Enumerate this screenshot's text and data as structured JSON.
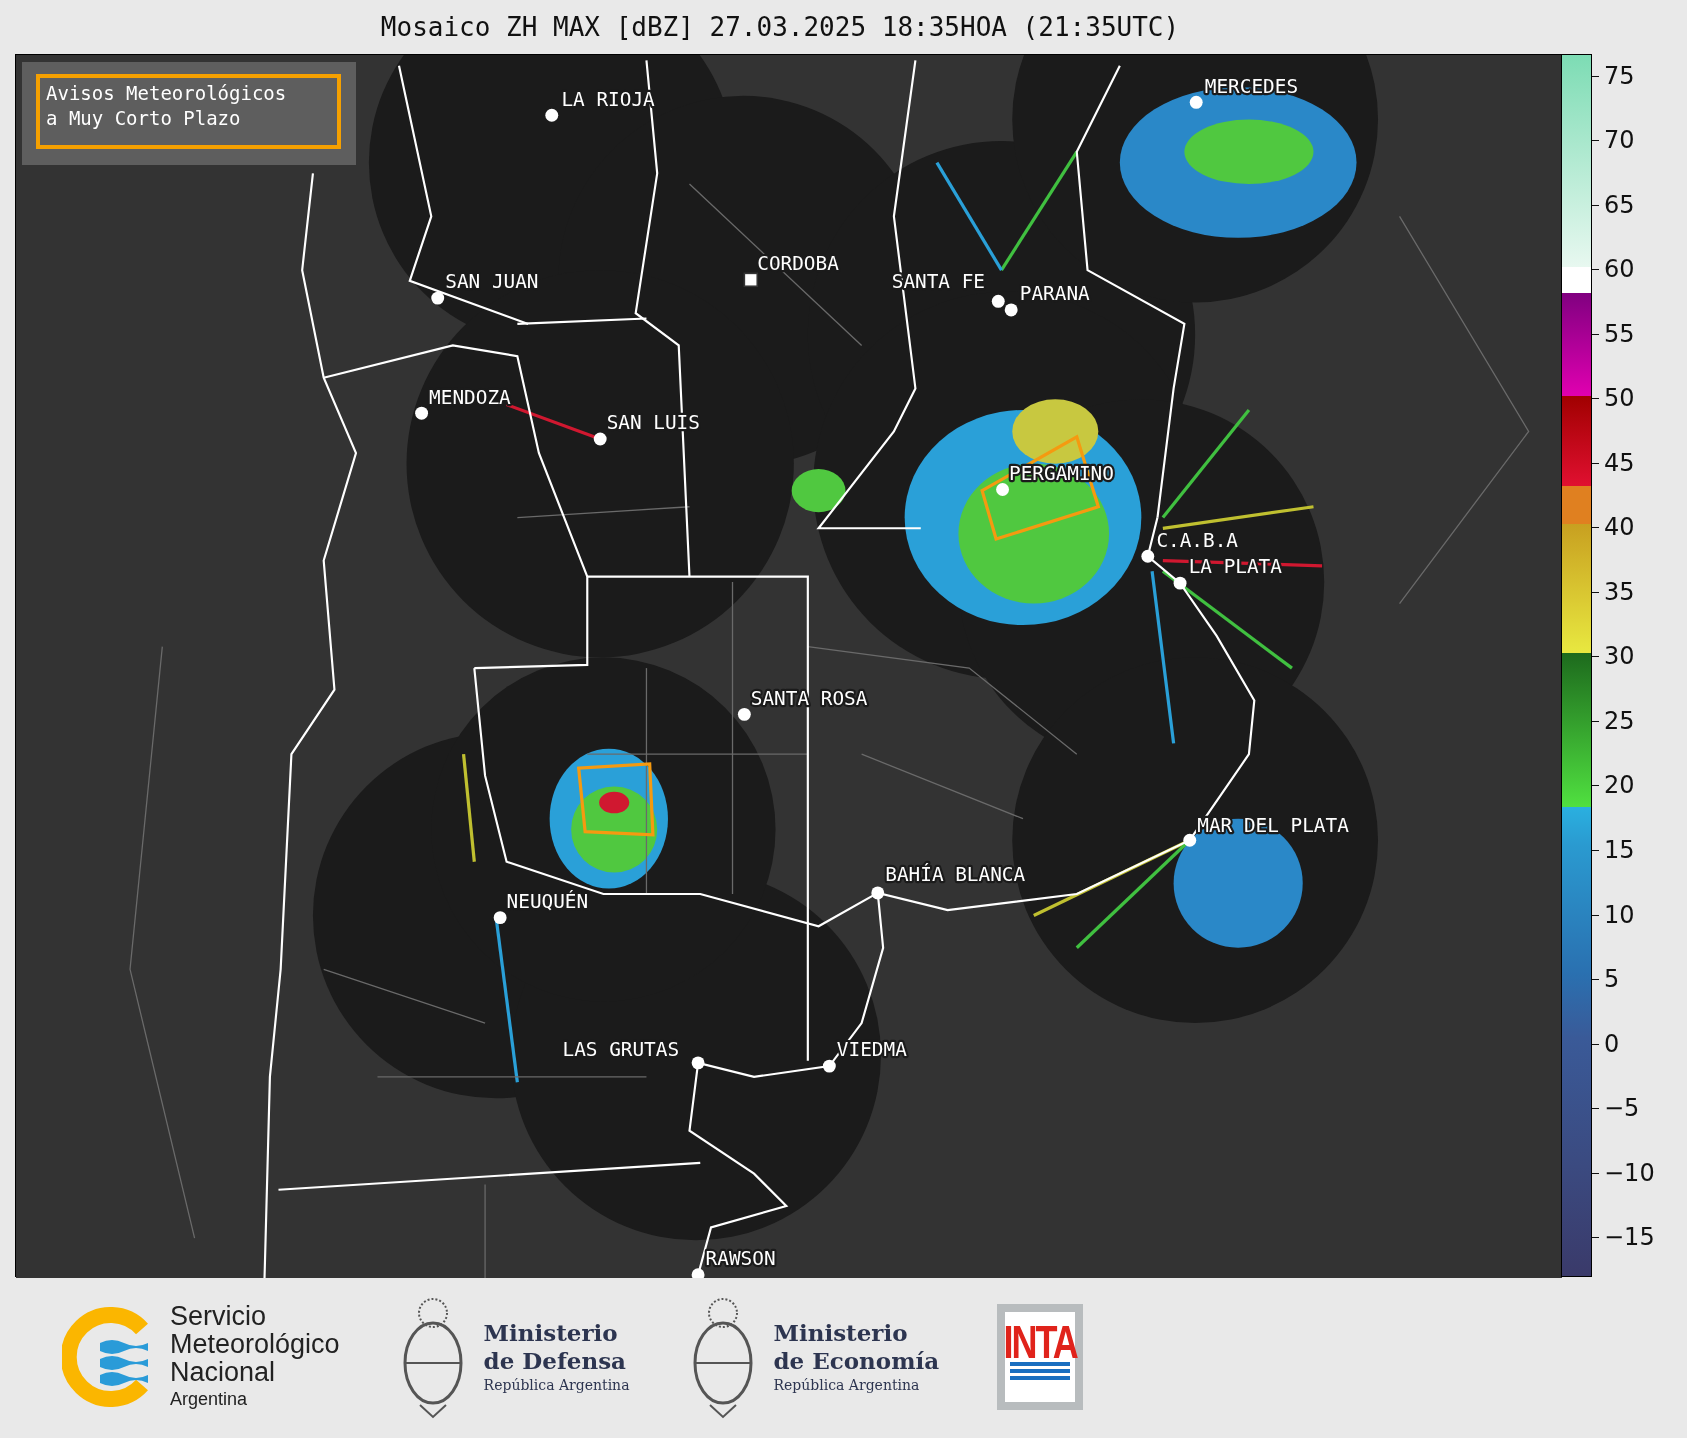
{
  "title": "Mosaico ZH MAX [dBZ] 27.03.2025 18:35HOA (21:35UTC)",
  "map": {
    "legend_box": {
      "lines": [
        "Avisos Meteorológicos",
        "a Muy Corto Plazo"
      ]
    },
    "cities": [
      "LA RIOJA",
      "SAN JUAN",
      "CORDOBA",
      "SANTA FE",
      "PARANA",
      "MENDOZA",
      "SAN LUIS",
      "MERCEDES",
      "PERGAMINO",
      "C.A.B.A",
      "LA PLATA",
      "SANTA ROSA",
      "MAR DEL PLATA",
      "BAHÍA BLANCA",
      "NEUQUÉN",
      "LAS GRUTAS",
      "VIEDMA",
      "RAWSON"
    ]
  },
  "colorbar": {
    "ticks": [
      "75",
      "70",
      "65",
      "60",
      "55",
      "50",
      "45",
      "40",
      "35",
      "30",
      "25",
      "20",
      "15",
      "10",
      "5",
      "0",
      "−5",
      "−10",
      "−15"
    ]
  },
  "logos": [
    {
      "kind": "smn",
      "lines": [
        "Servicio",
        "Meteorológico",
        "Nacional"
      ],
      "subtitle": "Argentina"
    },
    {
      "kind": "ministry",
      "lines": [
        "Ministerio",
        "de Defensa"
      ],
      "subtitle": "República Argentina"
    },
    {
      "kind": "ministry",
      "lines": [
        "Ministerio",
        "de Economía"
      ],
      "subtitle": "República Argentina"
    },
    {
      "kind": "inta",
      "text": "INTA"
    }
  ]
}
